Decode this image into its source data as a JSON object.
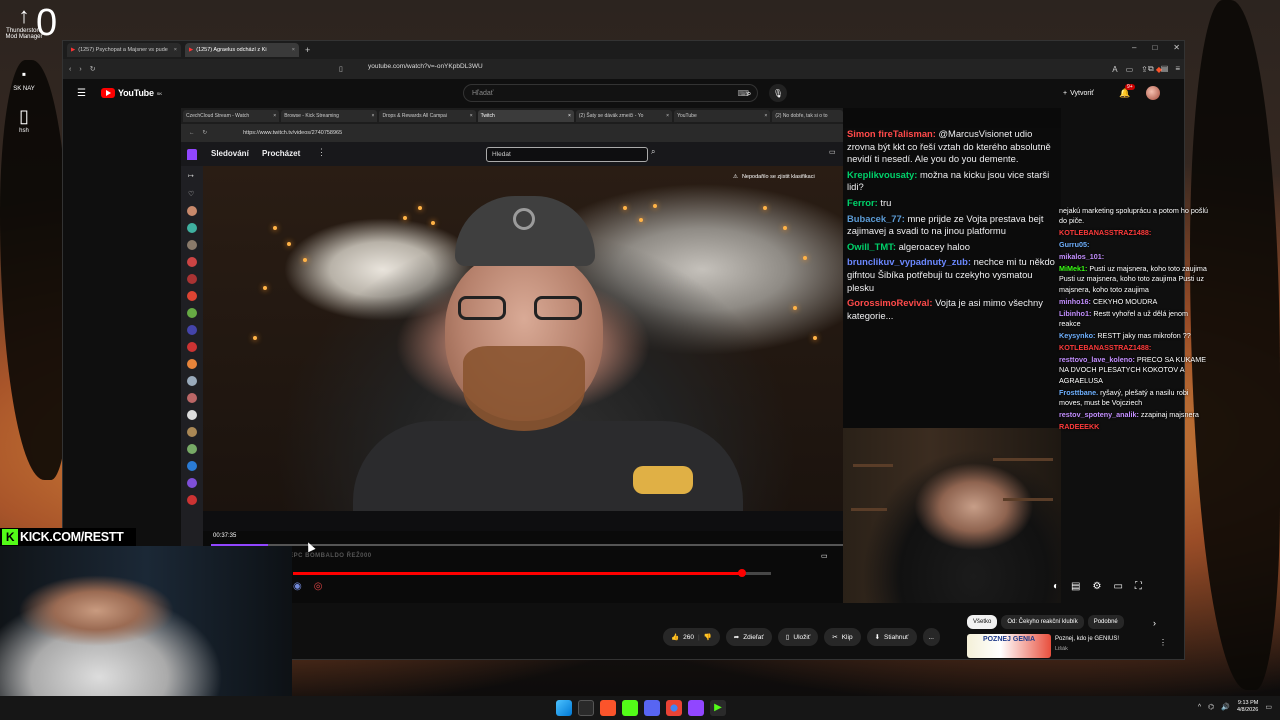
{
  "desktop": {
    "icons": [
      {
        "name": "Thunderstore Mod Manager",
        "icon": "arrow-up-icon"
      },
      {
        "name": "SK NAY",
        "icon": "app-icon"
      },
      {
        "name": "hsh",
        "icon": "file-icon"
      }
    ],
    "zero_label": "0"
  },
  "browser": {
    "tabs": [
      {
        "title": "(1257) Psychopat a Majsner vs pude",
        "active": false
      },
      {
        "title": "(1257) Agraelus odchází z Ki",
        "active": true
      }
    ],
    "url": "youtube.com/watch?v=-onYKpbDL3WU"
  },
  "youtube": {
    "logo_text": "YouTube",
    "country": "SK",
    "search_placeholder": "Hľadať",
    "create_label": "Vytvoriť",
    "notifications": "9+",
    "actions": {
      "likes": "260",
      "share": "Zdieľať",
      "save": "Uložiť",
      "clip": "Klip",
      "download": "Stiahnuť",
      "more": "..."
    },
    "chips": [
      "Všetko",
      "Od: Čekyho reakční klubík",
      "Podobné"
    ],
    "recommendation": {
      "thumb_text": "POZNEJ GENIA",
      "title": "Poznej, kdo je GENIUS!",
      "channel": "Lišák"
    },
    "progress_pct": 94
  },
  "inner": {
    "tabs": [
      {
        "title": "CzechCloud Stream - Watch",
        "active": false
      },
      {
        "title": "Browse - Kick Streaming",
        "active": false
      },
      {
        "title": "Drops & Rewards All Campai",
        "active": false
      },
      {
        "title": "Twitch",
        "active": true
      },
      {
        "title": "(2) Šaty se dávák zmeiči - Yo",
        "active": false
      },
      {
        "title": "YouTube",
        "active": false
      },
      {
        "title": "(2) No dobře, tak si o to",
        "active": false
      }
    ],
    "url": "https://www.twitch.tv/videos/2740758965",
    "twitch": {
      "nav_following": "Sledování",
      "nav_browse": "Procházet",
      "search_placeholder": "Hledat",
      "warning": "Nepodařilo se zjistit klasifikaci",
      "time": "00:37:35",
      "ticker": "PINKY REPC  BOMBALDO  ŘEŽ000",
      "progress_pct": 9
    }
  },
  "stream_chat": [
    {
      "user": "Simon fireTalisman:",
      "text": "@MarcusVisionet udio zrovna být kkt co řeší vztah do kterého absolutně nevidí ti nesedí. Ale you do you demente.",
      "color": "#ff4a4a"
    },
    {
      "user": "Kreplikvousaty:",
      "text": "možna na kicku jsou vice starši lidi?",
      "color": "#00d26a"
    },
    {
      "user": "Ferror:",
      "text": "tru",
      "color": "#00d26a"
    },
    {
      "user": "Bubacek_77:",
      "text": "mne prijde ze Vojta prestava bejt zajimavej a svadi to na jinou platformu",
      "color": "#5b9bd5"
    },
    {
      "user": "Owill_TMT:",
      "text": "algeroacey haloo",
      "color": "#00d26a"
    },
    {
      "user": "brunclikuv_vypadnuty_zub:",
      "text": "nechce mi tu někdo gifntou Šibíka potřebuji tu czekyho vysmatou plesku",
      "color": "#6b88ff"
    },
    {
      "user": "GorossimoRevival:",
      "text": "Vojta je asi mimo všechny kategorie...",
      "color": "#ff4a4a"
    }
  ],
  "overlay_chat": [
    {
      "user": "",
      "text": "nejakú marketing spoluprácu a potom ho pošlú do piče.",
      "color": "#ffffff"
    },
    {
      "user": "KOTLEBANASSTRAZ1488:",
      "text": "",
      "color": "#ff3b3b"
    },
    {
      "user": "Gurru05:",
      "text": "",
      "color": "#6fb1ff"
    },
    {
      "user": "mikalos_101:",
      "text": "",
      "color": "#c38fff"
    },
    {
      "user": "MiMek1:",
      "text": "Pusti uz majsnera, koho toto zaujima Pusti uz majsnera, koho toto zaujima Pusti uz majsnera, koho toto zaujima",
      "color": "#39ff14"
    },
    {
      "user": "minho16:",
      "text": "CEKYHO MOUDRA",
      "color": "#c38fff"
    },
    {
      "user": "Libinho1:",
      "text": "Restt vyhořel a už dělá jenom reakce",
      "color": "#c38fff"
    },
    {
      "user": "Keysynko:",
      "text": "RESTT jaky mas mikrofon ??",
      "color": "#6fb1ff"
    },
    {
      "user": "KOTLEBANASSTRAZ1488:",
      "text": "",
      "color": "#ff3b3b"
    },
    {
      "user": "resttovo_lave_koleno:",
      "text": "PRECO SA KUKAME NA DVOCH PLESATYCH KOKOTOV A AGRAELUSA",
      "color": "#c38fff"
    },
    {
      "user": "Frosttbane.",
      "text": "ryšavý, plešatý a nasilu robi moves, must be Vojcziech",
      "color": "#6fb1ff"
    },
    {
      "user": "restov_spoteny_analik:",
      "text": "zzapinaj majsnera",
      "color": "#c38fff"
    },
    {
      "user": "RADEEEKK",
      "text": "",
      "color": "#ff3b3b"
    }
  ],
  "kick_banner": "KICK.COM/RESTT",
  "taskbar": {
    "time": "9:13 PM",
    "date": "4/8/2026"
  }
}
